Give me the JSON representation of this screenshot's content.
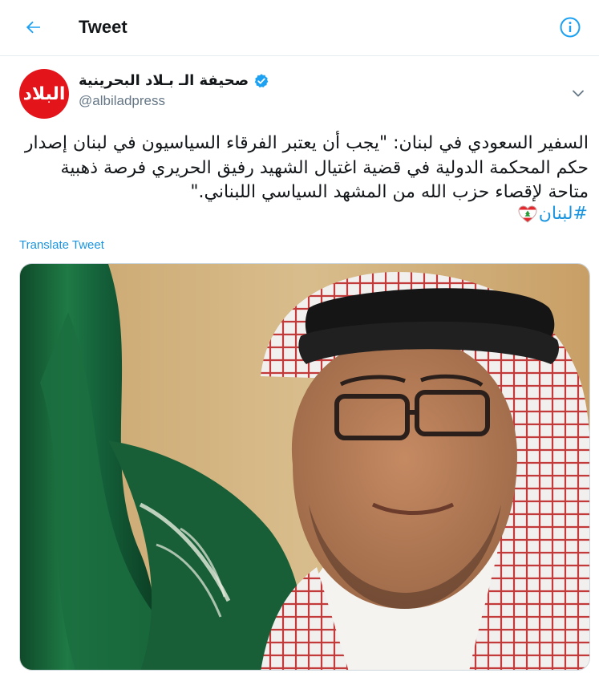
{
  "header": {
    "title": "Tweet",
    "back_icon": "arrow-left-icon",
    "info_icon": "info-icon"
  },
  "author": {
    "name": "صحيفة الـ بـلاد البحرينية",
    "handle": "@albiladpress",
    "avatar_text": "البلاد",
    "verified_icon": "verified-badge-icon"
  },
  "tweet": {
    "text": "السفير السعودي في لبنان: \"يجب أن يعتبر الفرقاء السياسيون في لبنان إصدار حكم المحكمة الدولية في قضية اغتيال الشهيد رفيق الحريري فرصة ذهبية متاحة لإقصاء حزب الله من المشهد السياسي اللبناني.\"",
    "hashtag": "#لبنان",
    "hashtag_emoji_icon": "lebanon-heart-emoji-icon",
    "translate_label": "Translate Tweet"
  },
  "colors": {
    "accent": "#1b95e0",
    "text": "#14171a",
    "secondary": "#657786",
    "avatar_bg": "#e3151b"
  }
}
